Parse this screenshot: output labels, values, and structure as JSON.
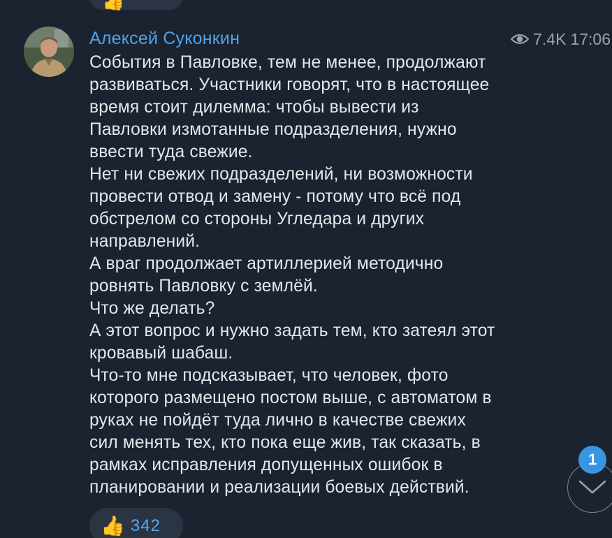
{
  "previous_message": {
    "reaction_emoji": "👍"
  },
  "post": {
    "sender": "Алексей Суконкин",
    "views": "7.4K",
    "time": "17:06",
    "lines": [
      "События в Павловке, тем не менее, продолжают",
      "развиваться. Участники говорят, что в настоящее",
      "время стоит дилемма: чтобы вывести из",
      "Павловки измотанные подразделения, нужно",
      "ввести туда свежие.",
      "Нет ни свежих подразделений, ни возможности",
      "провести отвод и замену - потому что всё под",
      "обстрелом со стороны Угледара и других",
      "направлений.",
      "А враг продолжает артиллерией методично",
      "ровнять Павловку с землёй.",
      "Что же делать?",
      "А этот вопрос и нужно задать тем, кто затеял этот",
      "кровавый шабаш.",
      "Что-то мне подсказывает, что человек, фото",
      "которого размещено постом выше, с автоматом в",
      "руках не пойдёт туда лично в качестве свежих",
      "сил менять тех, кто пока еще жив, так сказать, в",
      "рамках исправления допущенных ошибок в",
      "планировании и реализации боевых действий."
    ],
    "reaction": {
      "emoji": "👍",
      "count": "342"
    }
  },
  "scroll_button": {
    "unread_count": "1",
    "icon": "chevron-down-icon"
  },
  "colors": {
    "background": "#1b2330",
    "sender": "#4fa3e8",
    "text": "#e4e7eb",
    "meta": "#9aa4b0",
    "reaction_bg": "#2b3442",
    "reaction_count": "#58a6ea",
    "badge": "#3a95e0"
  }
}
